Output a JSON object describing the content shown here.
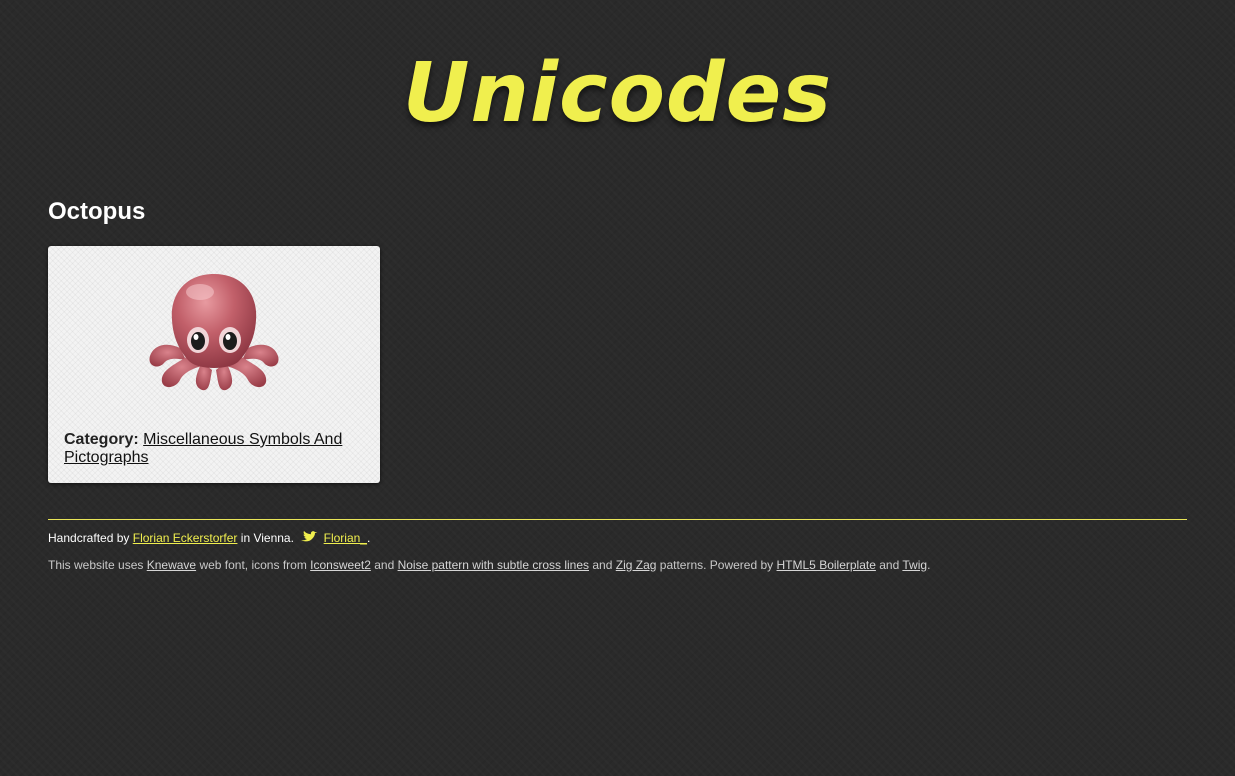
{
  "header": {
    "logo_text": "Unicodes"
  },
  "main": {
    "title": "Octopus",
    "card": {
      "glyph_icon": "octopus-emoji",
      "category_label": "Category:",
      "category_link": "Miscellaneous Symbols And Pictographs"
    }
  },
  "footer": {
    "credit_prefix": "Handcrafted by",
    "author_link": "Florian Eckerstorfer",
    "credit_location": "in Vienna.",
    "twitter_icon": "twitter-bird-icon",
    "twitter_link": "Florian_",
    "credit_end": ".",
    "uses_prefix": "This website uses",
    "font_link": "Knewave",
    "font_suffix": "web font, icons from",
    "icons_link": "Iconsweet2",
    "and_1": "and",
    "noise_link": "Noise pattern with subtle cross lines",
    "and_2": "and",
    "zigzag_link": "Zig Zag",
    "patterns_text": "patterns. Powered by",
    "boilerplate_link": "HTML5 Boilerplate",
    "and_3": "and",
    "twig_link": "Twig",
    "final_period": "."
  },
  "colors": {
    "background": "#2a2a2a",
    "accent_yellow": "#f0ef4e",
    "card_background": "#f3f3f3",
    "octopus_body": "#b5535a"
  }
}
